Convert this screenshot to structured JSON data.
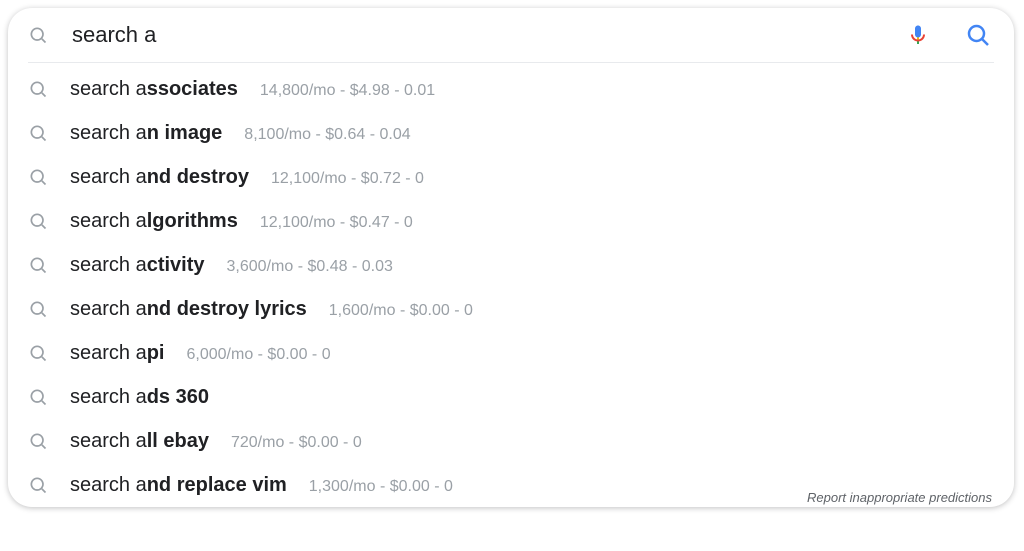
{
  "search": {
    "query": "search a"
  },
  "suggestions": [
    {
      "prefix": "search a",
      "completion": "ssociates",
      "stats": "14,800/mo - $4.98 - 0.01"
    },
    {
      "prefix": "search a",
      "completion": "n image",
      "stats": "8,100/mo - $0.64 - 0.04"
    },
    {
      "prefix": "search a",
      "completion": "nd destroy",
      "stats": "12,100/mo - $0.72 - 0"
    },
    {
      "prefix": "search a",
      "completion": "lgorithms",
      "stats": "12,100/mo - $0.47 - 0"
    },
    {
      "prefix": "search a",
      "completion": "ctivity",
      "stats": "3,600/mo - $0.48 - 0.03"
    },
    {
      "prefix": "search a",
      "completion": "nd destroy lyrics",
      "stats": "1,600/mo - $0.00 - 0"
    },
    {
      "prefix": "search a",
      "completion": "pi",
      "stats": "6,000/mo - $0.00 - 0"
    },
    {
      "prefix": "search a",
      "completion": "ds 360",
      "stats": ""
    },
    {
      "prefix": "search a",
      "completion": "ll ebay",
      "stats": "720/mo - $0.00 - 0"
    },
    {
      "prefix": "search a",
      "completion": "nd replace vim",
      "stats": "1,300/mo - $0.00 - 0"
    }
  ],
  "footer": {
    "report_label": "Report inappropriate predictions"
  }
}
